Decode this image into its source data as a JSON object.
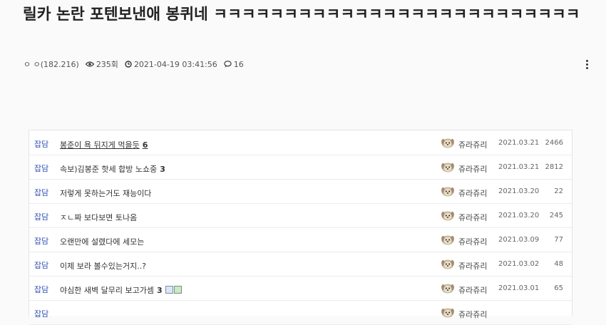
{
  "post": {
    "title": "릴카 논란 포텐보낸애 봉퀴네 ㅋㅋㅋㅋㅋㅋㅋㅋㅋㅋㅋㅋㅋㅋㅋㅋㅋㅋㅋㅋㅋㅋㅋㅋㅋㅋ",
    "author_level": "ㅇ ㅇ(182.216)",
    "views": "235회",
    "datetime": "2021-04-19 03:41:56",
    "comments": "16"
  },
  "icons": {
    "views": "eye-icon",
    "time": "clock-icon",
    "comments": "comment-icon",
    "more": "more-vertical-icon"
  },
  "colors": {
    "category": "#3253b3"
  },
  "list": [
    {
      "category": "잡담",
      "subject": "봉준이 욕 뒤지게 먹을듯",
      "count": "6",
      "author": "쥬라쥬리",
      "date": "2021.03.21",
      "views": "2466",
      "current": true
    },
    {
      "category": "잡담",
      "subject": "속보)김봉준 핫세 합방 노쇼중",
      "count": "3",
      "author": "쥬라쥬리",
      "date": "2021.03.21",
      "views": "2812"
    },
    {
      "category": "잡담",
      "subject": "저렇게 못하는거도 재능이다",
      "count": "",
      "author": "쥬라쥬리",
      "date": "2021.03.20",
      "views": "22"
    },
    {
      "category": "잡담",
      "subject": "ㅈㄴ짜 보다보면 토나옴",
      "count": "",
      "author": "쥬라쥬리",
      "date": "2021.03.20",
      "views": "245"
    },
    {
      "category": "잡담",
      "subject": "오랜만에 설렜다에 세모는",
      "count": "",
      "author": "쥬라쥬리",
      "date": "2021.03.09",
      "views": "77"
    },
    {
      "category": "잡담",
      "subject": "이제 보라 볼수있는거지..?",
      "count": "",
      "author": "쥬라쥬리",
      "date": "2021.03.02",
      "views": "48"
    },
    {
      "category": "잡담",
      "subject": "야심한 새벽 달무리 보고가셈",
      "count": "3",
      "author": "쥬라쥬리",
      "date": "2021.03.01",
      "views": "65",
      "attachments": true
    },
    {
      "category": "잡담",
      "subject": "",
      "count": "",
      "author": "쥬라쥬리",
      "date": "",
      "views": ""
    }
  ]
}
